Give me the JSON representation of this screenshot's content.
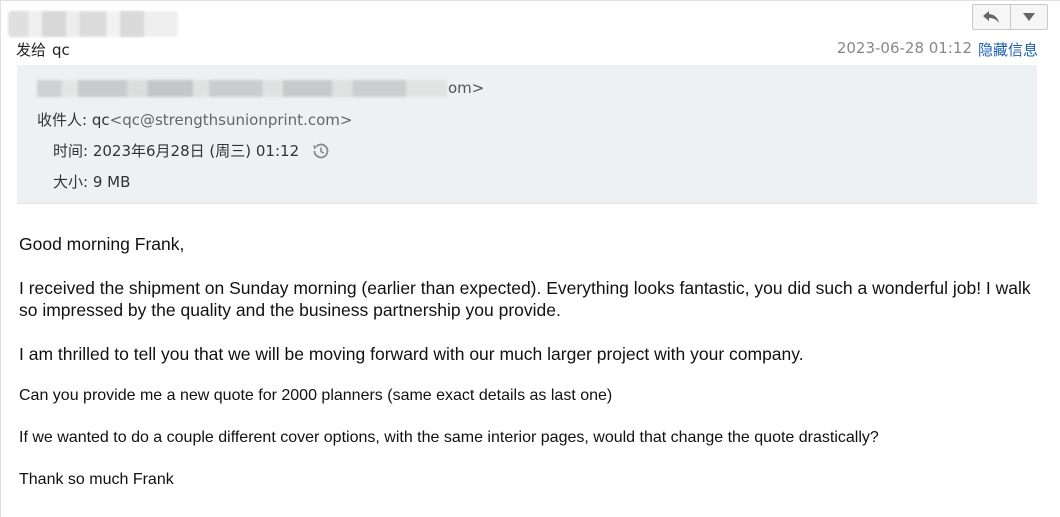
{
  "header": {
    "to_label": "发给",
    "to_name": "qc",
    "date": "2023-06-28 01:12",
    "hide_details": "隐藏信息"
  },
  "toolbar": {
    "reply_icon": "reply-icon",
    "more_icon": "dropdown-triangle-icon"
  },
  "details": {
    "from_tail": "om>",
    "recipient_label": "收件人:",
    "recipient_name": "qc",
    "recipient_email": "<qc@strengthsunionprint.com>",
    "time_label": "时间:",
    "time_value": "2023年6月28日 (周三) 01:12",
    "size_label": "大小:",
    "size_value": "9 MB"
  },
  "message": {
    "greeting": "Good morning Frank,",
    "para1": "I received the shipment on Sunday morning (earlier than expected). Everything looks fantastic, you did such a wonderful job! I walk so impressed by the quality and the business partnership you provide.",
    "para2": "I am thrilled to tell you that we will be moving forward with our much larger project with your company.",
    "para3": "Can you provide me a new quote for 2000 planners (same exact details as last one)",
    "para4": "If we wanted to do a couple different cover options, with the same interior pages, would that change the quote drastically?",
    "closing": "Thank so much Frank"
  }
}
